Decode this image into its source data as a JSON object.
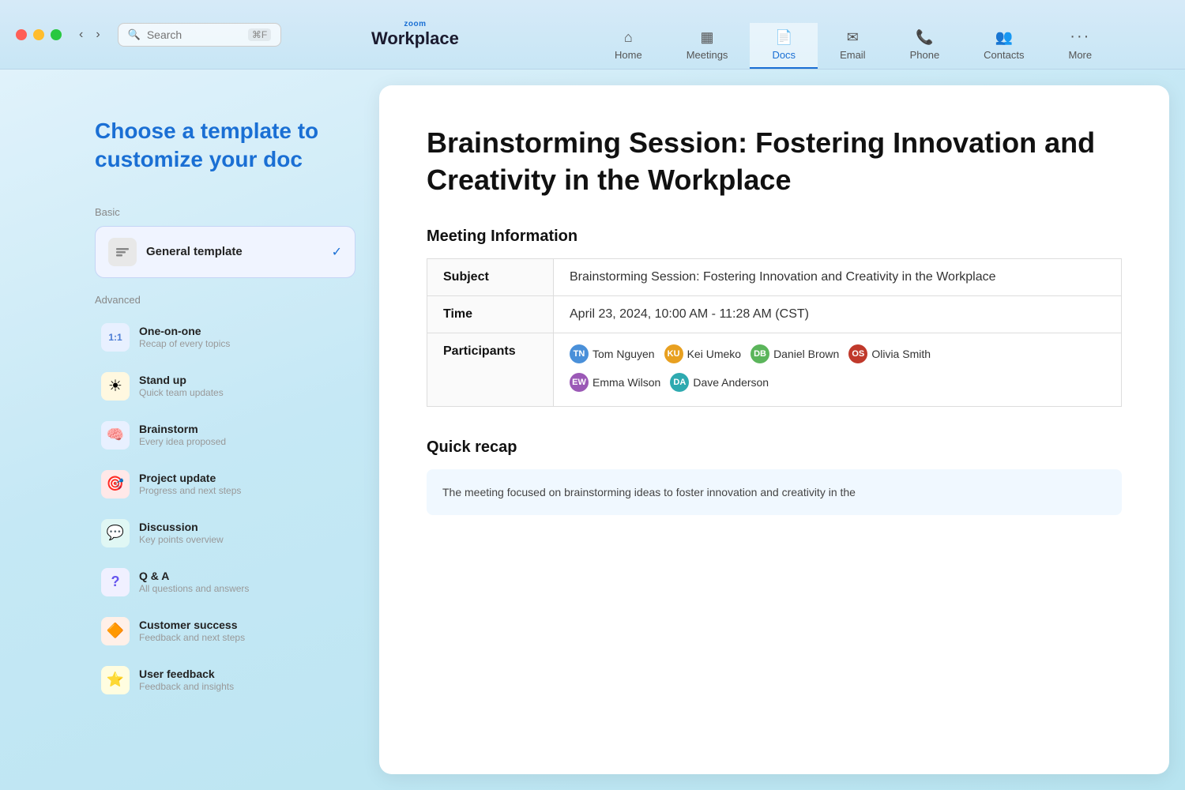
{
  "titlebar": {
    "brand_zoom": "zoom",
    "brand_name": "Workplace",
    "search_placeholder": "Search",
    "search_shortcut": "⌘F",
    "nav_back": "‹",
    "nav_forward": "›"
  },
  "nav_tabs": [
    {
      "id": "home",
      "label": "Home",
      "icon": "⌂"
    },
    {
      "id": "meetings",
      "label": "Meetings",
      "icon": "📅"
    },
    {
      "id": "docs",
      "label": "Docs",
      "icon": "📄",
      "active": true
    },
    {
      "id": "email",
      "label": "Email",
      "icon": "✉"
    },
    {
      "id": "phone",
      "label": "Phone",
      "icon": "📞"
    },
    {
      "id": "contacts",
      "label": "Contacts",
      "icon": "👥"
    },
    {
      "id": "more",
      "label": "More",
      "icon": "···"
    }
  ],
  "page_title": "Choose a template to customize your doc",
  "basic_label": "Basic",
  "advanced_label": "Advanced",
  "templates": {
    "general": {
      "name": "General template",
      "check": "✓",
      "icon": "👥"
    },
    "advanced": [
      {
        "id": "one-on-one",
        "name": "One-on-one",
        "desc": "Recap of every topics",
        "icon": "1:1",
        "icon_type": "text"
      },
      {
        "id": "standup",
        "name": "Stand up",
        "desc": "Quick team updates",
        "icon": "☀",
        "icon_type": "emoji"
      },
      {
        "id": "brainstorm",
        "name": "Brainstorm",
        "desc": "Every idea proposed",
        "icon": "🧠",
        "icon_type": "emoji"
      },
      {
        "id": "project-update",
        "name": "Project update",
        "desc": "Progress and next steps",
        "icon": "🎯",
        "icon_type": "emoji"
      },
      {
        "id": "discussion",
        "name": "Discussion",
        "desc": "Key points overview",
        "icon": "💬",
        "icon_type": "emoji"
      },
      {
        "id": "qa",
        "name": "Q & A",
        "desc": "All questions and answers",
        "icon": "?",
        "icon_type": "text"
      },
      {
        "id": "customer-success",
        "name": "Customer success",
        "desc": "Feedback and next steps",
        "icon": "🔶",
        "icon_type": "emoji"
      },
      {
        "id": "user-feedback",
        "name": "User feedback",
        "desc": "Feedback and insights",
        "icon": "⭐",
        "icon_type": "emoji"
      }
    ]
  },
  "preview": {
    "doc_title": "Brainstorming Session: Fostering Innovation and Creativity in the Workplace",
    "meeting_info_heading": "Meeting Information",
    "table": {
      "subject_label": "Subject",
      "subject_value": "Brainstorming Session: Fostering Innovation and Creativity in the Workplace",
      "time_label": "Time",
      "time_value": "April 23, 2024, 10:00 AM - 11:28 AM (CST)",
      "participants_label": "Participants"
    },
    "participants": [
      {
        "name": "Tom Nguyen",
        "color": "#4a90d9"
      },
      {
        "name": "Kei Umeko",
        "color": "#e8a020"
      },
      {
        "name": "Daniel Brown",
        "color": "#5bb55b"
      },
      {
        "name": "Olivia Smith",
        "color": "#c0392b"
      },
      {
        "name": "Emma Wilson",
        "color": "#9b59b6"
      },
      {
        "name": "Dave Anderson",
        "color": "#2eaab0"
      }
    ],
    "recap_heading": "Quick recap",
    "recap_text": "The meeting focused on brainstorming ideas to foster innovation and creativity in the"
  }
}
